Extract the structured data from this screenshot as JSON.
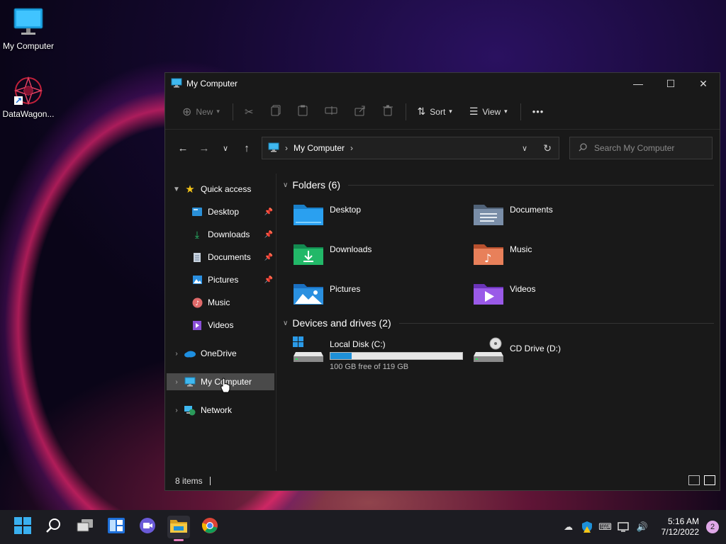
{
  "desktop": {
    "icons": [
      {
        "label": "My Computer",
        "icon": "monitor-icon"
      },
      {
        "label": "DataWagon...",
        "icon": "datawagon-shortcut-icon"
      }
    ]
  },
  "window": {
    "title": "My Computer",
    "controls": {
      "minimize": "—",
      "maximize": "☐",
      "close": "✕"
    }
  },
  "toolbar": {
    "new_label": "New",
    "sort_label": "Sort",
    "view_label": "View",
    "more_label": "•••"
  },
  "address": {
    "crumb": "My Computer",
    "search_placeholder": "Search My Computer"
  },
  "sidebar": {
    "quick_access": "Quick access",
    "items": [
      {
        "label": "Desktop",
        "pinned": true
      },
      {
        "label": "Downloads",
        "pinned": true
      },
      {
        "label": "Documents",
        "pinned": true
      },
      {
        "label": "Pictures",
        "pinned": true
      },
      {
        "label": "Music",
        "pinned": false
      },
      {
        "label": "Videos",
        "pinned": false
      }
    ],
    "onedrive": "OneDrive",
    "mycomputer": "My Computer",
    "network": "Network"
  },
  "content": {
    "folders_header": "Folders (6)",
    "folders": [
      {
        "label": "Desktop",
        "color": "#1e90d8"
      },
      {
        "label": "Documents",
        "color": "#6a7f9a"
      },
      {
        "label": "Downloads",
        "color": "#1fae6a"
      },
      {
        "label": "Music",
        "color": "#e0734a"
      },
      {
        "label": "Pictures",
        "color": "#2a8fe0"
      },
      {
        "label": "Videos",
        "color": "#8a4fd8"
      }
    ],
    "drives_header": "Devices and drives (2)",
    "drives": [
      {
        "label": "Local Disk (C:)",
        "free_text": "100 GB free of 119 GB",
        "used_fraction": 0.16
      },
      {
        "label": "CD Drive (D:)"
      }
    ]
  },
  "status": {
    "items_count": "8 items"
  },
  "taskbar": {
    "time": "5:16 AM",
    "date": "7/12/2022",
    "notifications": "2"
  }
}
